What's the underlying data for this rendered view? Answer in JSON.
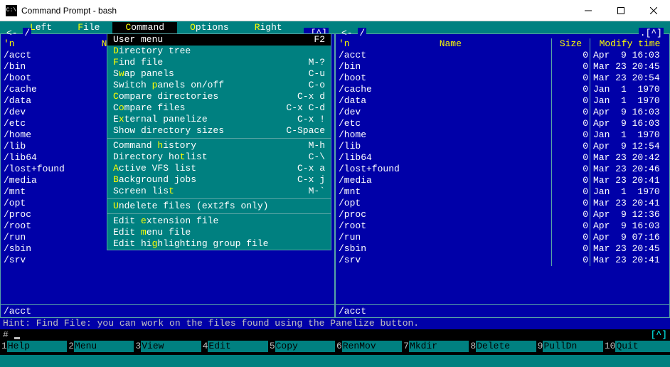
{
  "window": {
    "title": "Command Prompt - bash",
    "icon_label": "C:\\"
  },
  "menubar": [
    {
      "label": "Left",
      "hotkey_pos": 0
    },
    {
      "label": "File",
      "hotkey_pos": 0
    },
    {
      "label": "Command",
      "hotkey_pos": 0,
      "active": true
    },
    {
      "label": "Options",
      "hotkey_pos": 0
    },
    {
      "label": "Right",
      "hotkey_pos": 0
    }
  ],
  "dropdown": {
    "items": [
      {
        "label": "User menu",
        "hk": null,
        "shortcut": "F2",
        "selected": true
      },
      {
        "label": "Directory tree",
        "hk": 0
      },
      {
        "label": "Find file",
        "hk": 0,
        "shortcut": "M-?"
      },
      {
        "label": "Swap panels",
        "hk": 1,
        "shortcut": "C-u"
      },
      {
        "label": "Switch panels on/off",
        "hk": 7,
        "shortcut": "C-o"
      },
      {
        "label": "Compare directories",
        "hk": 0,
        "shortcut": "C-x d"
      },
      {
        "label": "Compare files",
        "hk": 1,
        "shortcut": "C-x C-d"
      },
      {
        "label": "External panelize",
        "hk": 1,
        "shortcut": "C-x !"
      },
      {
        "label": "Show directory sizes",
        "hk": 14,
        "shortcut": "C-Space"
      },
      {
        "sep": true
      },
      {
        "label": "Command history",
        "hk": 8,
        "shortcut": "M-h"
      },
      {
        "label": "Directory hotlist",
        "hk": 12,
        "shortcut": "C-\\"
      },
      {
        "label": "Active VFS list",
        "hk": 0,
        "shortcut": "C-x a"
      },
      {
        "label": "Background jobs",
        "hk": 0,
        "shortcut": "C-x j"
      },
      {
        "label": "Screen list",
        "hk": 10,
        "shortcut": "M-`"
      },
      {
        "sep": true
      },
      {
        "label": "Undelete files (ext2fs only)",
        "hk": 0
      },
      {
        "sep": true
      },
      {
        "label": "Edit extension file",
        "hk": 5
      },
      {
        "label": "Edit menu file",
        "hk": 5
      },
      {
        "label": "Edit highlighting group file",
        "hk": 7
      }
    ]
  },
  "left_panel": {
    "path": "/",
    "indicators": ".[^]",
    "col_name": "N",
    "entries": [
      "/acct",
      "/bin",
      "/boot",
      "/cache",
      "/data",
      "/dev",
      "/etc",
      "/home",
      "/lib",
      "/lib64",
      "/lost+found",
      "/media",
      "/mnt",
      "/opt",
      "/proc",
      "/root",
      "/run",
      "/sbin",
      "/srv"
    ],
    "selected": "/acct"
  },
  "right_panel": {
    "path": "/",
    "indicators": ".[^]",
    "col_name": "Name",
    "col_size": "Size",
    "col_mtime": "Modify time",
    "entries": [
      {
        "n": "/acct",
        "s": "0",
        "m": "Apr  9 16:03"
      },
      {
        "n": "/bin",
        "s": "0",
        "m": "Mar 23 20:45"
      },
      {
        "n": "/boot",
        "s": "0",
        "m": "Mar 23 20:54"
      },
      {
        "n": "/cache",
        "s": "0",
        "m": "Jan  1  1970"
      },
      {
        "n": "/data",
        "s": "0",
        "m": "Jan  1  1970"
      },
      {
        "n": "/dev",
        "s": "0",
        "m": "Apr  9 16:03"
      },
      {
        "n": "/etc",
        "s": "0",
        "m": "Apr  9 16:03"
      },
      {
        "n": "/home",
        "s": "0",
        "m": "Jan  1  1970"
      },
      {
        "n": "/lib",
        "s": "0",
        "m": "Apr  9 12:54"
      },
      {
        "n": "/lib64",
        "s": "0",
        "m": "Mar 23 20:42"
      },
      {
        "n": "/lost+found",
        "s": "0",
        "m": "Mar 23 20:46"
      },
      {
        "n": "/media",
        "s": "0",
        "m": "Mar 23 20:41"
      },
      {
        "n": "/mnt",
        "s": "0",
        "m": "Jan  1  1970"
      },
      {
        "n": "/opt",
        "s": "0",
        "m": "Mar 23 20:41"
      },
      {
        "n": "/proc",
        "s": "0",
        "m": "Apr  9 12:36"
      },
      {
        "n": "/root",
        "s": "0",
        "m": "Apr  9 16:03"
      },
      {
        "n": "/run",
        "s": "0",
        "m": "Apr  9 07:16"
      },
      {
        "n": "/sbin",
        "s": "0",
        "m": "Mar 23 20:45"
      },
      {
        "n": "/srv",
        "s": "0",
        "m": "Mar 23 20:41"
      }
    ],
    "selected": "/acct"
  },
  "hint": "Hint: Find File: you can work on the files found using the Panelize button.",
  "prompt": "# ",
  "caret_indicator": "[^]",
  "fkeys": [
    {
      "n": "1",
      "l": "Help"
    },
    {
      "n": "2",
      "l": "Menu"
    },
    {
      "n": "3",
      "l": "View"
    },
    {
      "n": "4",
      "l": "Edit"
    },
    {
      "n": "5",
      "l": "Copy"
    },
    {
      "n": "6",
      "l": "RenMov"
    },
    {
      "n": "7",
      "l": "Mkdir"
    },
    {
      "n": "8",
      "l": "Delete"
    },
    {
      "n": "9",
      "l": "PullDn"
    },
    {
      "n": "10",
      "l": "Quit"
    }
  ]
}
